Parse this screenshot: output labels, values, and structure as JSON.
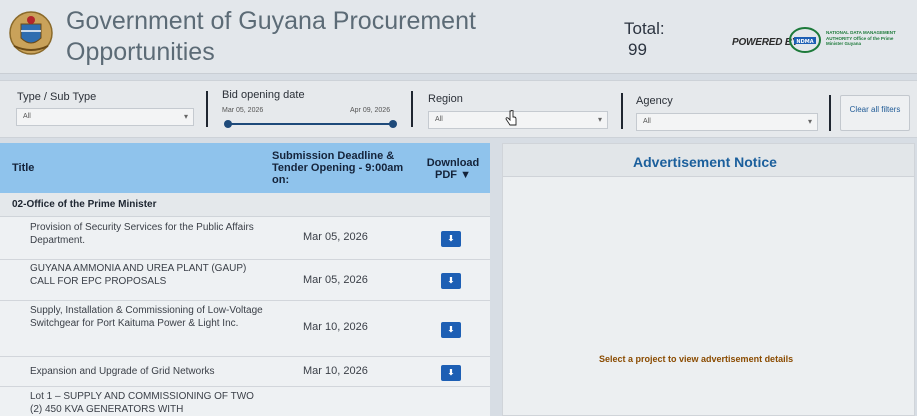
{
  "header": {
    "title": "Government of Guyana Procurement Opportunities",
    "total_label": "Total:",
    "total_value": "99",
    "powered_by": "POWERED BY",
    "nmda_logo": "NDMA",
    "nmda_text": "NATIONAL DATA MANAGEMENT AUTHORITY Office of the Prime Minister Guyana"
  },
  "filters": {
    "type_label": "Type / Sub Type",
    "type_value": "All",
    "bid_label": "Bid opening date",
    "bid_start": "Mar 05, 2026",
    "bid_end": "Apr 09, 2026",
    "region_label": "Region",
    "region_value": "All",
    "agency_label": "Agency",
    "agency_value": "All",
    "clear_label": "Clear all filters"
  },
  "table": {
    "col_title": "Title",
    "col_deadline": "Submission Deadline & Tender Opening - 9:00am on:",
    "col_download": "Download PDF ▼",
    "group": "02-Office of the Prime Minister",
    "rows": [
      {
        "title": "Provision of Security Services for the Public Affairs Department.",
        "date": "Mar 05, 2026"
      },
      {
        "title": "GUYANA AMMONIA AND UREA PLANT (GAUP) CALL FOR EPC PROPOSALS",
        "date": "Mar 05, 2026"
      },
      {
        "title": "Supply, Installation & Commissioning of Low-Voltage Switchgear for Port Kaituma Power & Light Inc.",
        "date": "Mar 10, 2026"
      },
      {
        "title": "Expansion and Upgrade of Grid Networks",
        "date": "Mar 10, 2026"
      },
      {
        "title": "Lot 1 – SUPPLY AND COMMISSIONING OF TWO (2) 450 KVA GENERATORS WITH",
        "date": ""
      }
    ],
    "download_glyph": "⬇"
  },
  "ad": {
    "title": "Advertisement Notice",
    "message": "Select a project to view advertisement details"
  },
  "colors": {
    "header_blue": "#8fc3ec",
    "accent": "#1d5fb4",
    "notice": "#8a4b00"
  }
}
